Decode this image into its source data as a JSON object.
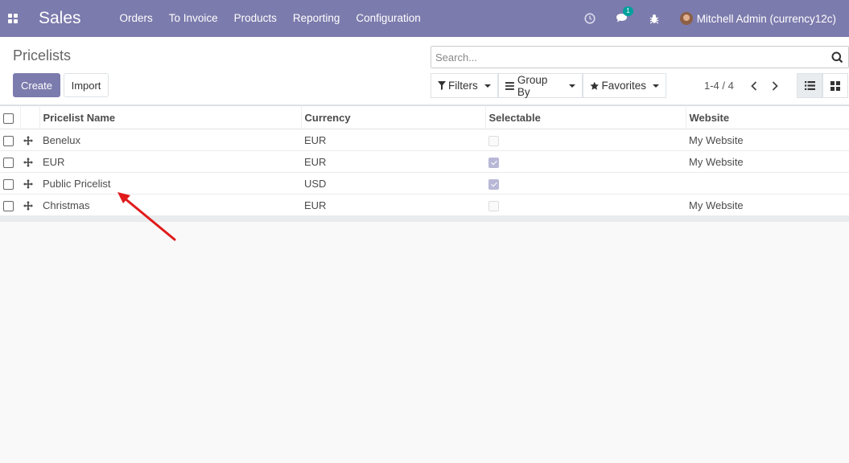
{
  "navbar": {
    "app_name": "Sales",
    "menu": [
      "Orders",
      "To Invoice",
      "Products",
      "Reporting",
      "Configuration"
    ],
    "chat_badge": "1",
    "user_name": "Mitchell Admin (currency12c)"
  },
  "control_panel": {
    "title": "Pricelists",
    "create_label": "Create",
    "import_label": "Import",
    "search_placeholder": "Search...",
    "filters_label": "Filters",
    "groupby_label": "Group By",
    "favorites_label": "Favorites",
    "pager": "1-4 / 4"
  },
  "table": {
    "columns": [
      "Pricelist Name",
      "Currency",
      "Selectable",
      "Website"
    ],
    "rows": [
      {
        "name": "Benelux",
        "currency": "EUR",
        "selectable": false,
        "website": "My Website"
      },
      {
        "name": "EUR",
        "currency": "EUR",
        "selectable": true,
        "website": "My Website"
      },
      {
        "name": "Public Pricelist",
        "currency": "USD",
        "selectable": true,
        "website": ""
      },
      {
        "name": "Christmas",
        "currency": "EUR",
        "selectable": false,
        "website": "My Website"
      }
    ]
  },
  "colors": {
    "brand": "#7c7bad",
    "annotation_arrow": "#e01b1b"
  }
}
